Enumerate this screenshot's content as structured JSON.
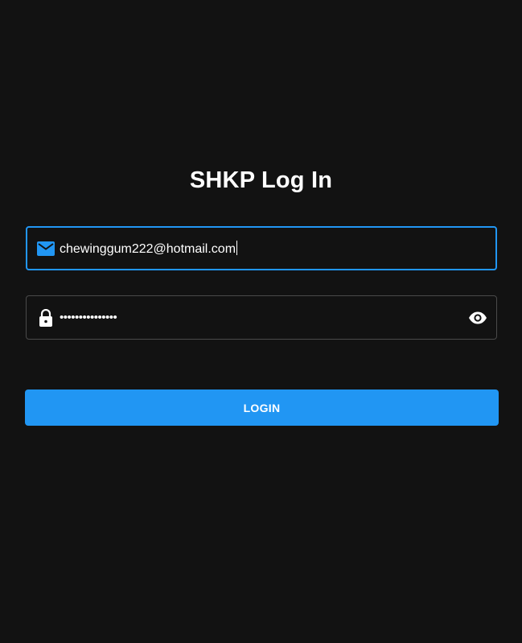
{
  "page": {
    "title": "SHKP Log In"
  },
  "form": {
    "email": {
      "value": "chewinggum222@hotmail.com",
      "icon": "mail-icon"
    },
    "password": {
      "masked_value": "•••••••••••••••",
      "icon": "lock-icon",
      "toggle_icon": "eye-icon"
    },
    "login_label": "LOGIN"
  },
  "colors": {
    "background": "#121212",
    "accent": "#2196f3",
    "text": "#ffffff",
    "border": "#4a4a4a"
  }
}
